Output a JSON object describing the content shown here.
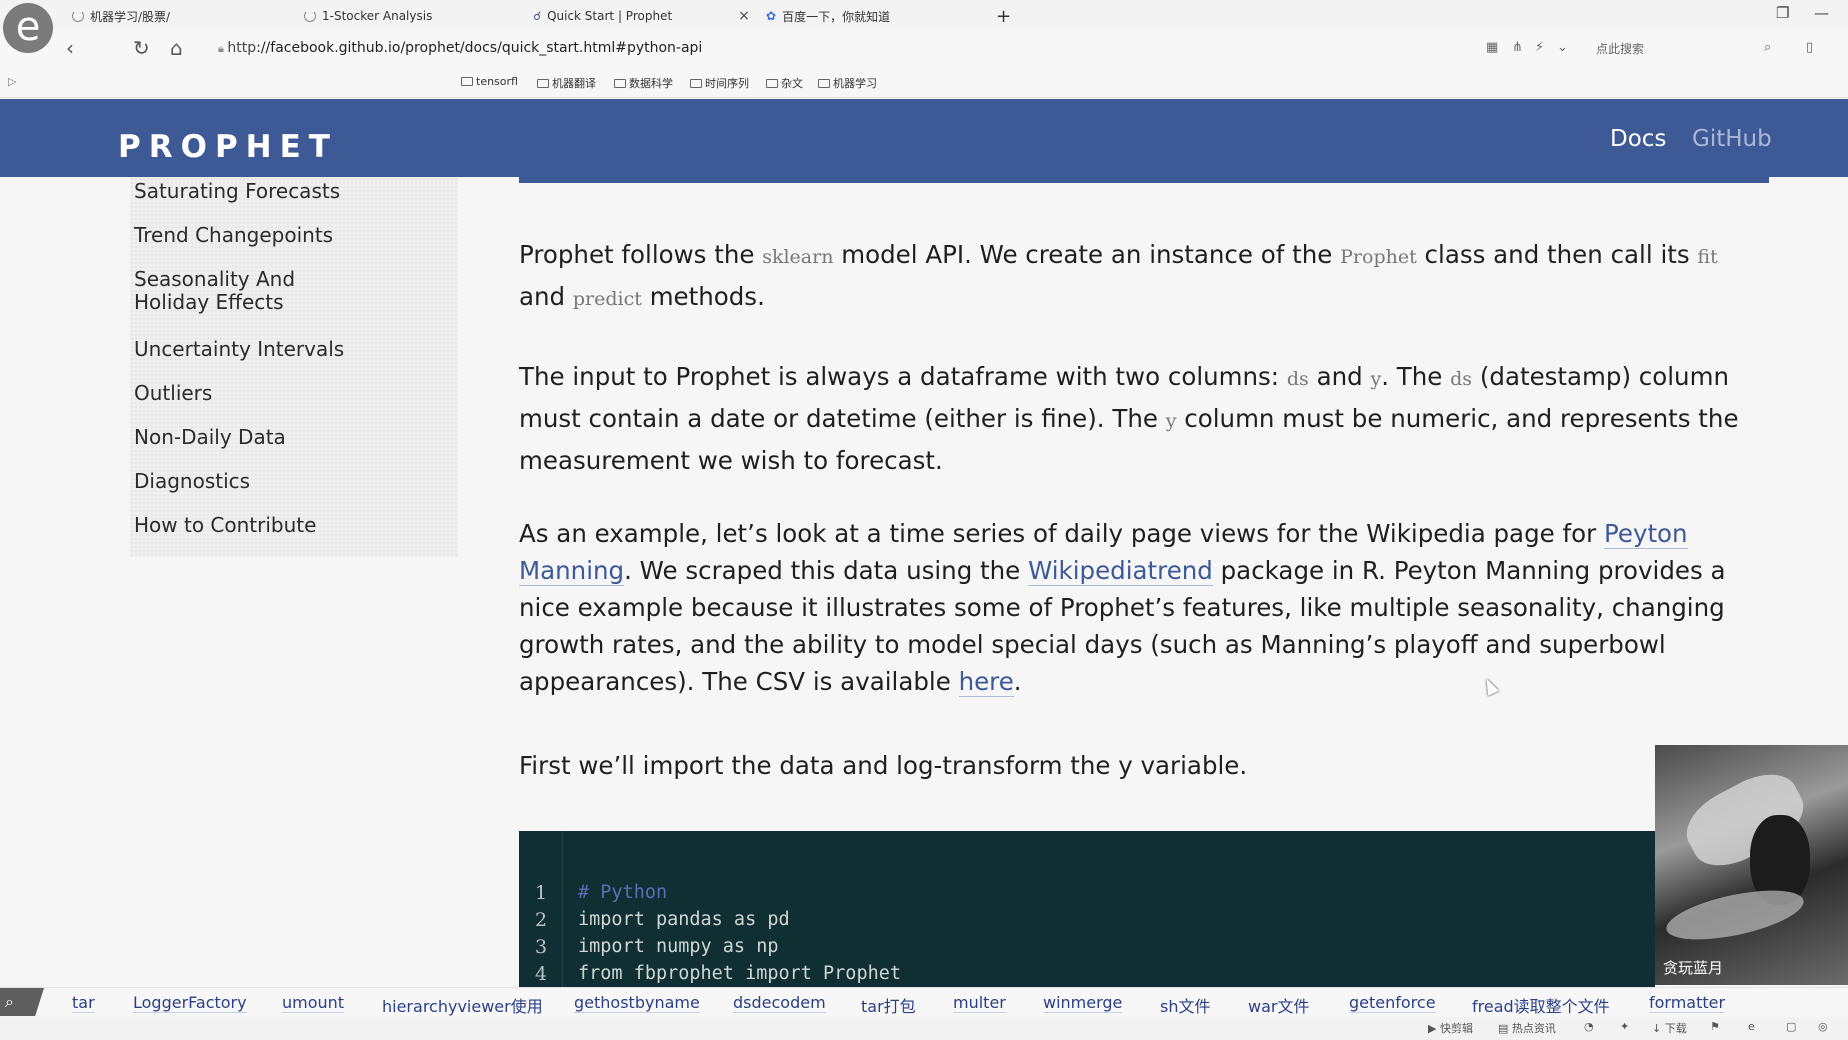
{
  "browser": {
    "tabs": [
      {
        "label": "机器学习/股票/"
      },
      {
        "label": "1-Stocker Analysis"
      },
      {
        "label": "Quick Start | Prophet"
      },
      {
        "label": "百度一下，你就知道"
      }
    ],
    "new_tab": "+",
    "url_scheme": "http",
    "url_rest": "://facebook.github.io/prophet/docs/quick_start.html#python-api",
    "search_hint": "点此搜索",
    "bookmarks": [
      "tensorfl",
      "机器翻译",
      "数据科学",
      "时间序列",
      "杂文",
      "机器学习"
    ]
  },
  "site": {
    "logo": "PROPHET",
    "nav": {
      "docs": "Docs",
      "github": "GitHub"
    }
  },
  "sidebar": {
    "items": [
      "Saturating Forecasts",
      "Trend Changepoints",
      "Seasonality And Holiday Effects",
      "Uncertainty Intervals",
      "Outliers",
      "Non-Daily Data",
      "Diagnostics",
      "How to Contribute"
    ]
  },
  "main": {
    "p1": {
      "t1": "Prophet follows the ",
      "c1": "sklearn",
      "t2": " model API. We create an instance of the ",
      "c2": "Prophet",
      "t3": " class and then call its ",
      "c3": "fit",
      "t4": " and ",
      "c4": "predict",
      "t5": " methods."
    },
    "p2": {
      "t1": "The input to Prophet is always a dataframe with two columns: ",
      "c1": "ds",
      "t2": " and ",
      "c2": "y",
      "t3": ". The ",
      "c3": "ds",
      "t4": " (datestamp) column must contain a date or datetime (either is fine). The ",
      "c4": "y",
      "t5": " column must be numeric, and represents the measurement we wish to forecast."
    },
    "p3": {
      "t1": "As an example, let’s look at a time series of daily page views for the Wikipedia page for ",
      "l1": "Peyton Manning",
      "t2": ". We scraped this data using the ",
      "l2": "Wikipediatrend",
      "t3": " package in R. Peyton Manning provides a nice example because it illustrates some of Prophet’s features, like multiple seasonality, changing growth rates, and the ability to model special days (such as Manning’s playoff and superbowl appearances). The CSV is available ",
      "l3": "here",
      "t4": "."
    },
    "p4": "First we’ll import the data and log-transform the y variable.",
    "code": {
      "line_numbers": [
        "1",
        "2",
        "3",
        "4"
      ],
      "lines": [
        "# Python",
        "import pandas as pd",
        "import numpy as np",
        "from fbprophet import Prophet"
      ]
    }
  },
  "video": {
    "caption": "贪玩蓝月"
  },
  "tag_links": [
    "tar",
    "LoggerFactory",
    "umount",
    "hierarchyviewer使用",
    "gethostbyname",
    "dsdecodem",
    "tar打包",
    "multer",
    "winmerge",
    "sh文件",
    "war文件",
    "getenforce",
    "fread读取整个文件",
    "formatter"
  ],
  "status": {
    "clip": "快剪辑",
    "news": "热点资讯",
    "download": "下载"
  }
}
